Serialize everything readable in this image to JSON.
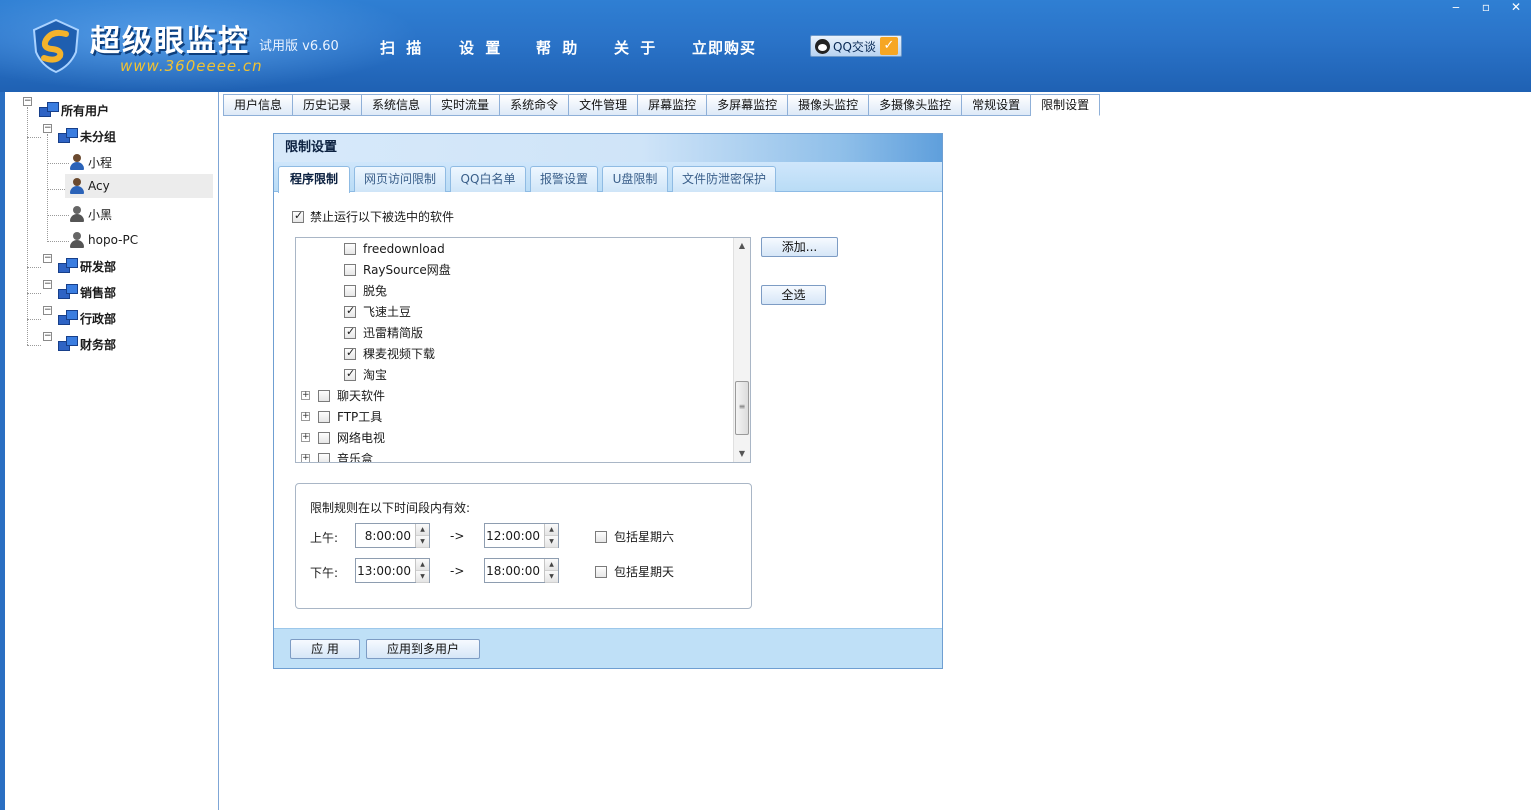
{
  "app": {
    "title": "超级眼监控",
    "edition": "试用版 v6.60",
    "url": "www.360eeee.cn"
  },
  "topmenu": [
    "扫 描",
    "设 置",
    "帮 助",
    "关 于",
    "立即购买"
  ],
  "qq_button": "QQ交谈",
  "window_controls": {
    "minimize": "‒",
    "maximize": "▫",
    "close": "✕"
  },
  "tree": {
    "root": "所有用户",
    "groups": [
      {
        "label": "未分组",
        "users": [
          "小程",
          "Acy",
          "小黑",
          "hopo-PC"
        ]
      },
      {
        "label": "研发部"
      },
      {
        "label": "销售部"
      },
      {
        "label": "行政部"
      },
      {
        "label": "财务部"
      }
    ],
    "selected_user": "Acy"
  },
  "tabs": [
    "用户信息",
    "历史记录",
    "系统信息",
    "实时流量",
    "系统命令",
    "文件管理",
    "屏幕监控",
    "多屏幕监控",
    "摄像头监控",
    "多摄像头监控",
    "常规设置",
    "限制设置"
  ],
  "active_tab": "限制设置",
  "dialog": {
    "title": "限制设置",
    "subtabs": [
      "程序限制",
      "网页访问限制",
      "QQ白名单",
      "报警设置",
      "U盘限制",
      "文件防泄密保护"
    ],
    "active_subtab": "程序限制",
    "main_check_label": "禁止运行以下被选中的软件",
    "main_checked": true,
    "software_items": [
      {
        "label": "freedownload",
        "checked": false
      },
      {
        "label": "RaySource网盘",
        "checked": false
      },
      {
        "label": "脱兔",
        "checked": false
      },
      {
        "label": "飞速土豆",
        "checked": true
      },
      {
        "label": "迅雷精简版",
        "checked": true
      },
      {
        "label": "稞麦视频下载",
        "checked": true
      },
      {
        "label": "淘宝",
        "checked": true
      }
    ],
    "software_groups": [
      {
        "label": "聊天软件",
        "checked": false
      },
      {
        "label": "FTP工具",
        "checked": false
      },
      {
        "label": "网络电视",
        "checked": false
      },
      {
        "label": "音乐盒",
        "checked": false
      }
    ],
    "buttons": {
      "add": "添加...",
      "select_all": "全选",
      "apply": "应 用",
      "apply_multi": "应用到多用户"
    },
    "schedule": {
      "caption": "限制规则在以下时间段内有效:",
      "morning_label": "上午:",
      "afternoon_label": "下午:",
      "morning_start": "8:00:00",
      "morning_end": "12:00:00",
      "afternoon_start": "13:00:00",
      "afternoon_end": "18:00:00",
      "arrow": "->",
      "saturday_label": "包括星期六",
      "sunday_label": "包括星期天",
      "saturday_checked": false,
      "sunday_checked": false
    }
  }
}
